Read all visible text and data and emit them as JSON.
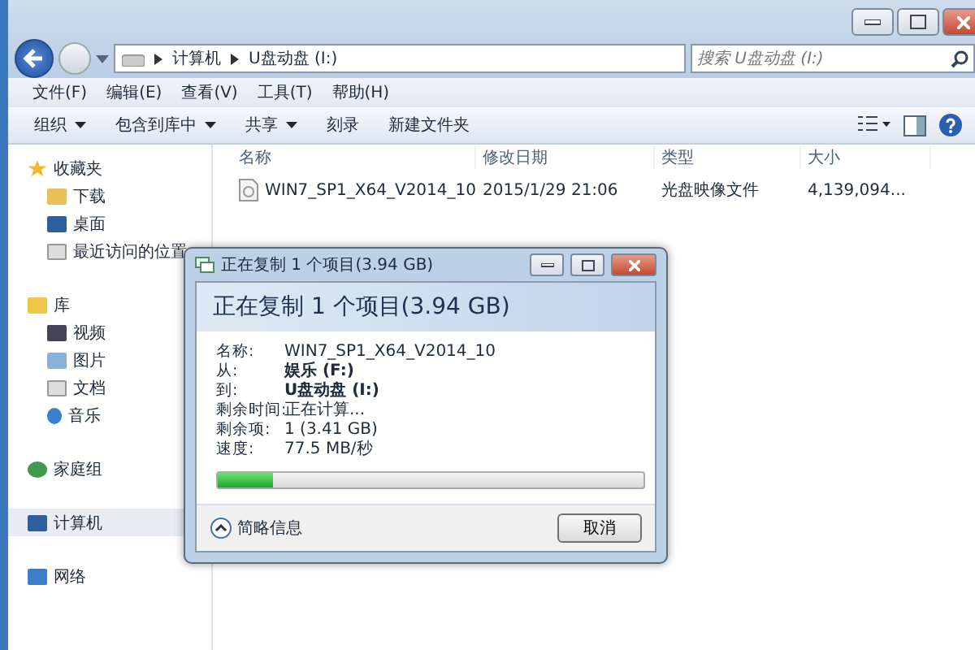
{
  "address": {
    "crumbs": [
      "计算机",
      "U盘动盘 (I:)"
    ]
  },
  "search": {
    "placeholder": "搜索 U盘动盘 (I:)"
  },
  "menu": [
    "文件(F)",
    "编辑(E)",
    "查看(V)",
    "工具(T)",
    "帮助(H)"
  ],
  "toolbar": [
    {
      "label": "组织",
      "dropdown": true
    },
    {
      "label": "包含到库中",
      "dropdown": true
    },
    {
      "label": "共享",
      "dropdown": true
    },
    {
      "label": "刻录",
      "dropdown": false
    },
    {
      "label": "新建文件夹",
      "dropdown": false
    }
  ],
  "sidebar": {
    "groups": [
      {
        "label": "收藏夹",
        "kind": "star",
        "selected": false,
        "children": [
          {
            "label": "下载",
            "kind": "download",
            "selected": false
          },
          {
            "label": "桌面",
            "kind": "desktop",
            "selected": false
          },
          {
            "label": "最近访问的位置",
            "kind": "recent",
            "selected": false
          }
        ]
      },
      {
        "label": "库",
        "kind": "library",
        "selected": false,
        "children": [
          {
            "label": "视频",
            "kind": "video",
            "selected": false
          },
          {
            "label": "图片",
            "kind": "picture",
            "selected": false
          },
          {
            "label": "文档",
            "kind": "document",
            "selected": false
          },
          {
            "label": "音乐",
            "kind": "music",
            "selected": false
          }
        ]
      },
      {
        "label": "家庭组",
        "kind": "homegroup",
        "selected": false
      },
      {
        "label": "计算机",
        "kind": "computer",
        "selected": true
      },
      {
        "label": "网络",
        "kind": "network",
        "selected": false
      }
    ]
  },
  "table": {
    "columns": [
      "名称",
      "修改日期",
      "类型",
      "大小"
    ],
    "rows": [
      [
        "WIN7_SP1_X64_V2014_10",
        "2015/1/29 21:06",
        "光盘映像文件",
        "4,139,094..."
      ]
    ]
  },
  "copy_dialog": {
    "title": "正在复制 1 个项目(3.94 GB)",
    "heading": "正在复制 1 个项目(3.94 GB)",
    "fields": [
      {
        "label": "名称:",
        "value": "WIN7_SP1_X64_V2014_10",
        "emphasis": false
      },
      {
        "label": "从:",
        "value": "娱乐 (F:)",
        "emphasis": true
      },
      {
        "label": "到:",
        "value": "U盘动盘 (I:)",
        "emphasis": true
      },
      {
        "label": "剩余时间:",
        "value": "正在计算...",
        "emphasis": false
      },
      {
        "label": "剩余项:",
        "value": "1 (3.41 GB)",
        "emphasis": false
      },
      {
        "label": "速度:",
        "value": "77.5 MB/秒",
        "emphasis": false
      }
    ],
    "progress": {
      "level": 0.13
    },
    "details_toggle": "简略信息",
    "cancel_button": "取消"
  }
}
